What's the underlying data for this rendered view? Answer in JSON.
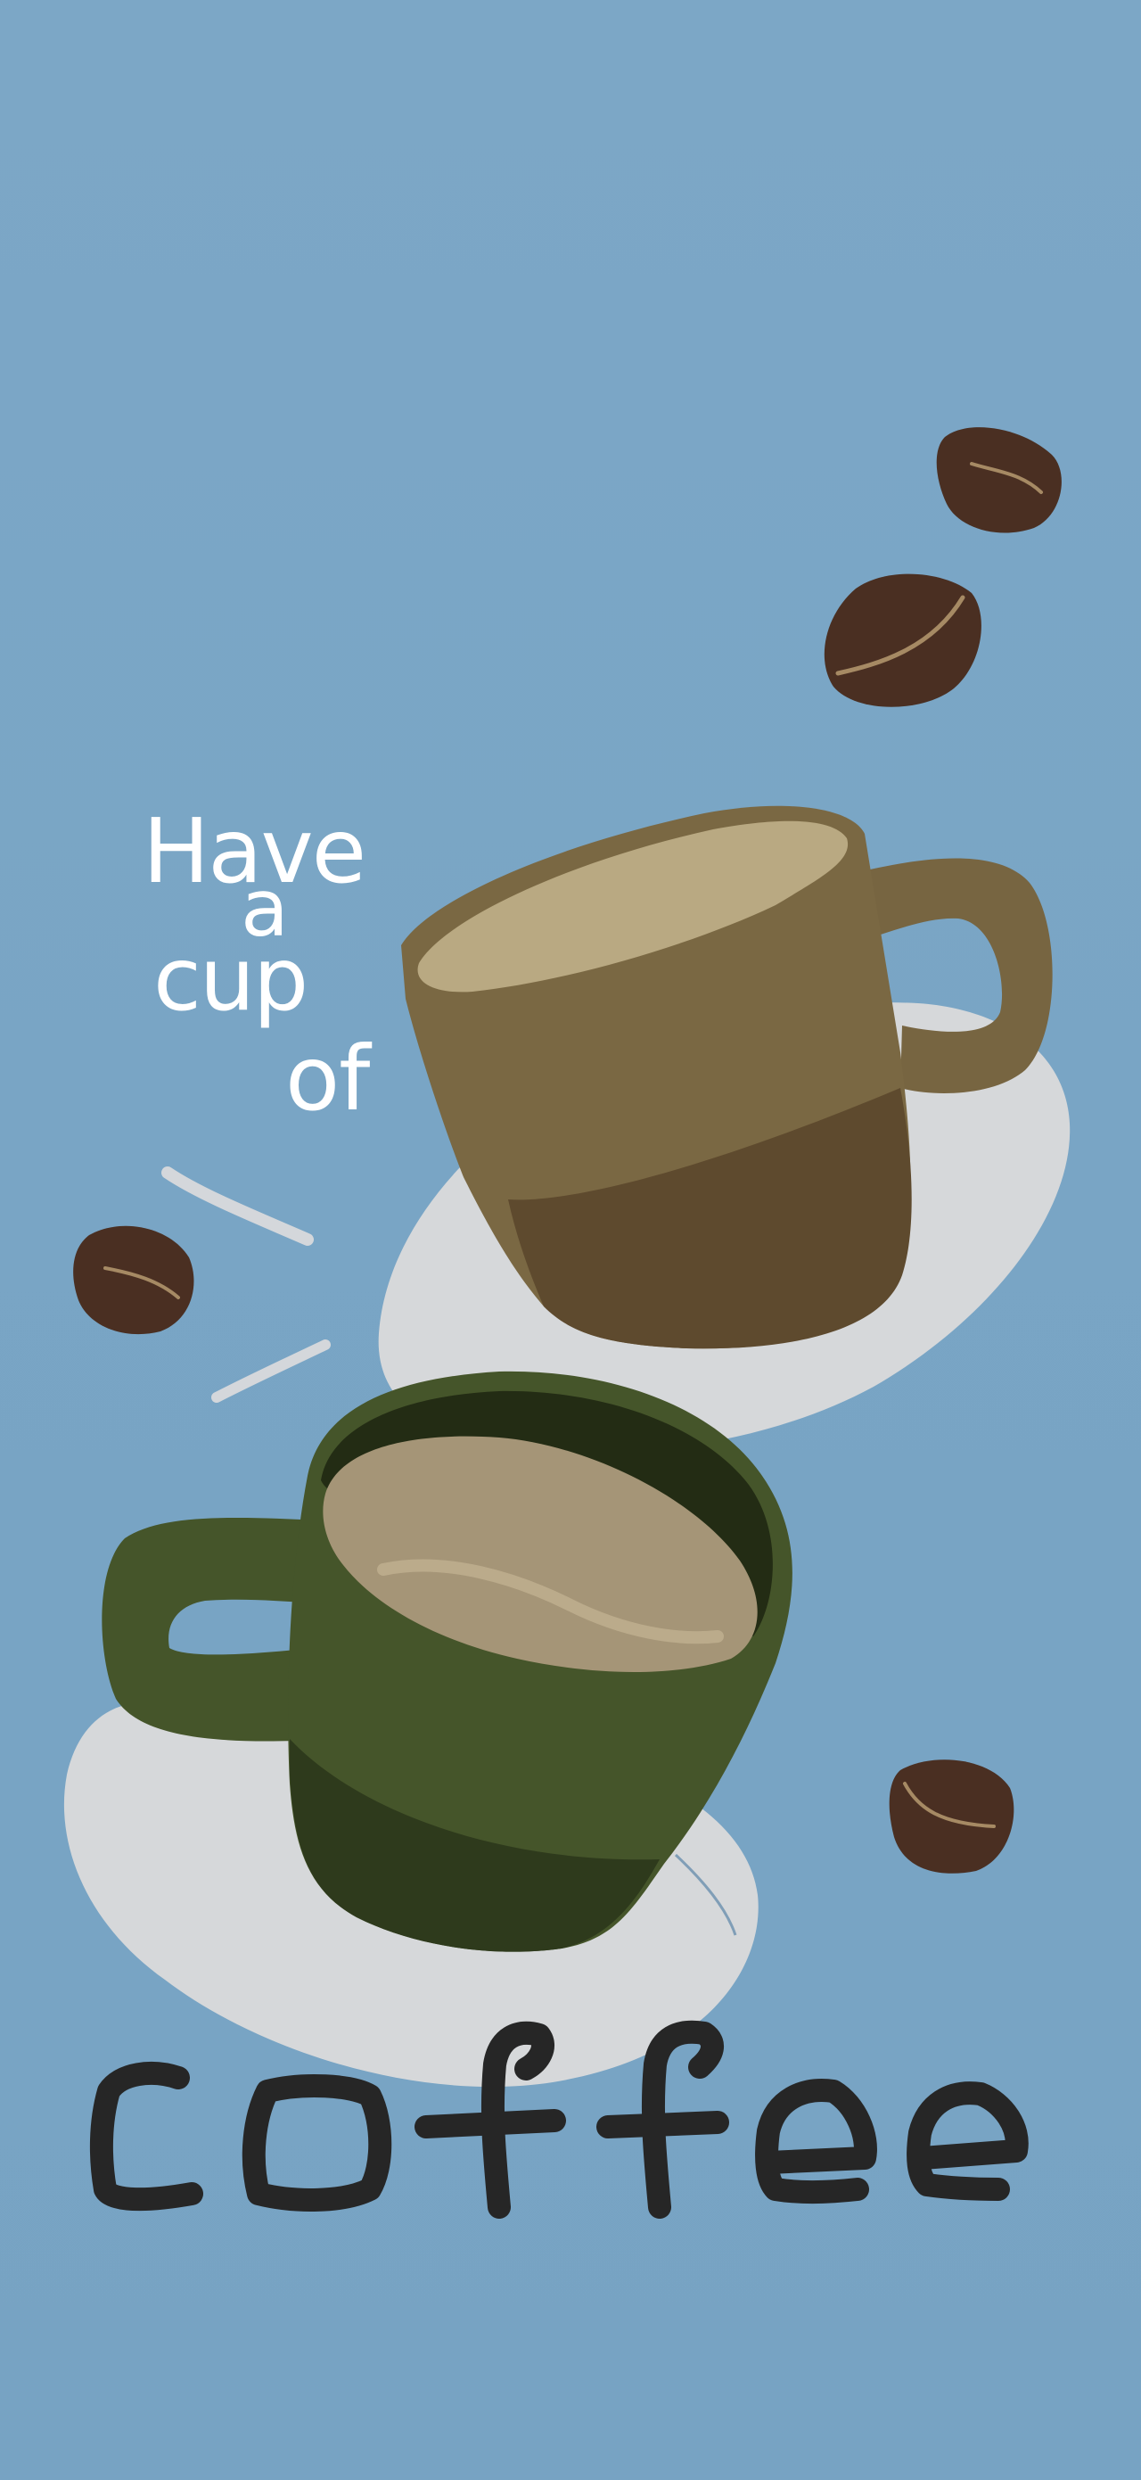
{
  "poster": {
    "headline_words": [
      "Have",
      "a",
      "cup",
      "of"
    ],
    "main_word": "coffee"
  },
  "colors": {
    "background": "#7BA6C6",
    "headline_text": "#FFFFFF",
    "main_word": "#262626",
    "saucer": "#D6D8DA",
    "brown_cup": "#7A6843",
    "brown_cup_shadow": "#5E4A2E",
    "green_cup": "#45552A",
    "green_cup_shadow": "#2E3A1C",
    "coffee_surface": "#B9A982",
    "bean": "#4A2F22",
    "bean_crease": "#A68A64",
    "motion_lines": "#D4D7DB"
  }
}
